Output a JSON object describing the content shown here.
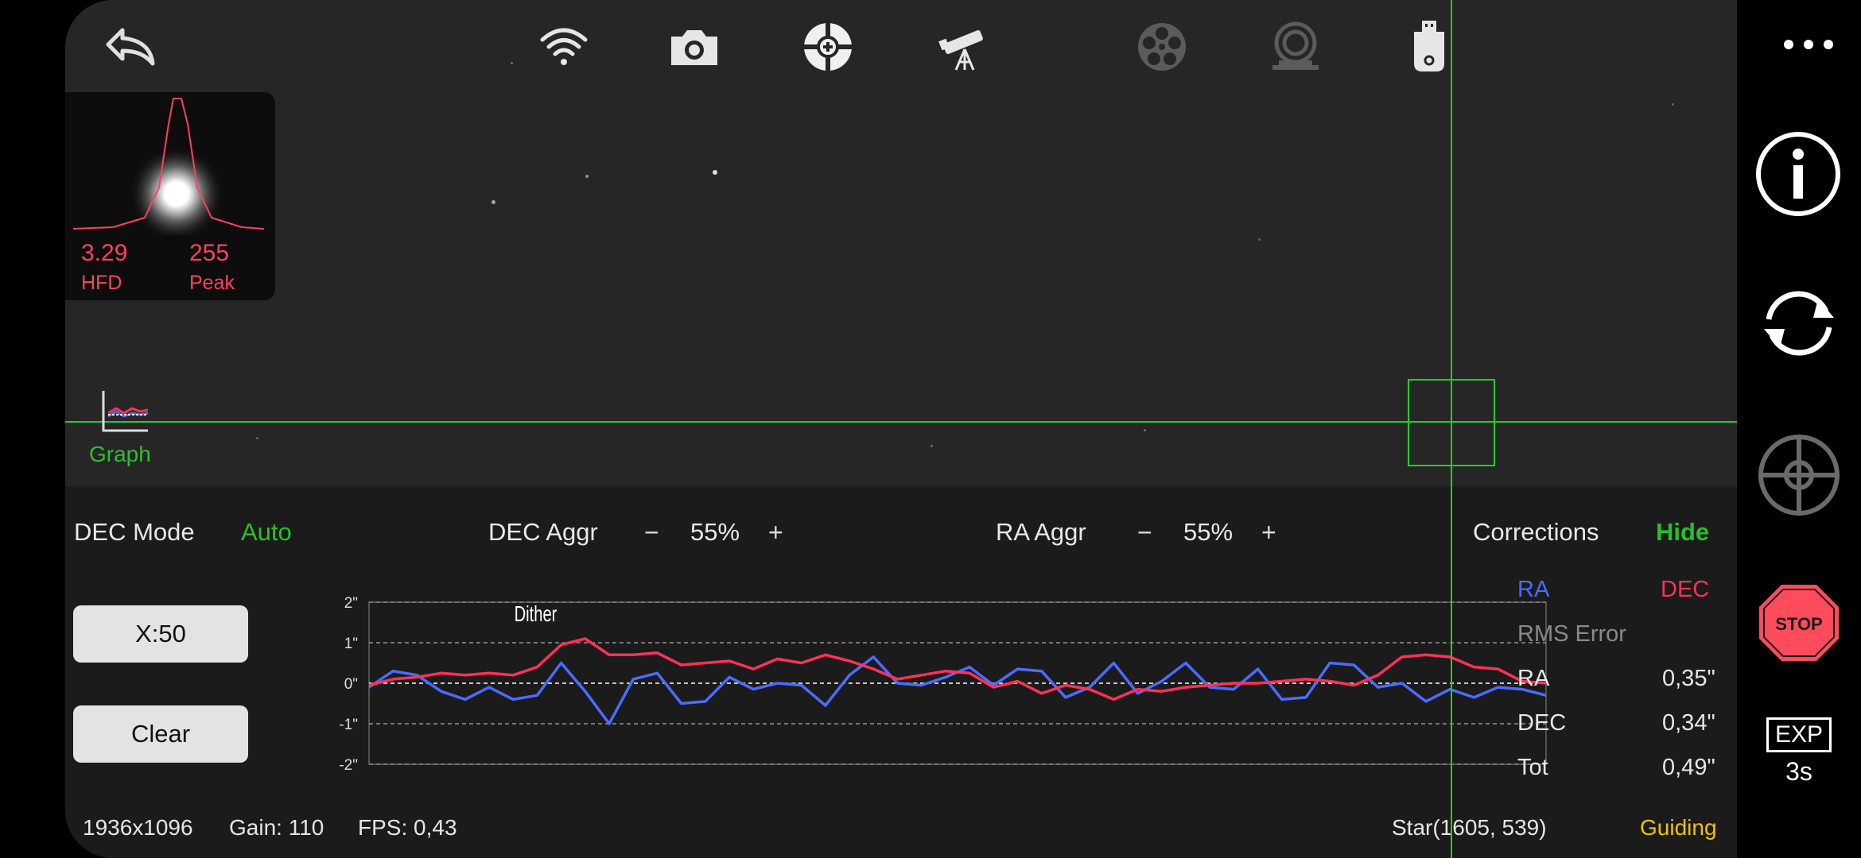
{
  "toolbar": {
    "icons": [
      "back-icon",
      "wifi-icon",
      "camera-icon",
      "guide-target-icon",
      "telescope-icon",
      "filter-wheel-icon",
      "focuser-icon",
      "usb-drive-icon"
    ]
  },
  "star_profile": {
    "hfd_value": "3.29",
    "hfd_label": "HFD",
    "peak_value": "255",
    "peak_label": "Peak"
  },
  "graph_toggle": {
    "label": "Graph"
  },
  "controls": {
    "dec_mode_label": "DEC Mode",
    "dec_mode_value": "Auto",
    "dec_aggr_label": "DEC Aggr",
    "dec_aggr_minus": "−",
    "dec_aggr_value": "55%",
    "dec_aggr_plus": "+",
    "ra_aggr_label": "RA Aggr",
    "ra_aggr_minus": "−",
    "ra_aggr_value": "55%",
    "ra_aggr_plus": "+",
    "corrections_label": "Corrections",
    "corrections_toggle": "Hide"
  },
  "buttons": {
    "x_scale": "X:50",
    "clear": "Clear"
  },
  "chart_data": {
    "type": "line",
    "yticks": [
      "2\"",
      "1\"",
      "0\"",
      "-1\"",
      "-2\""
    ],
    "ylim": [
      -2,
      2
    ],
    "annotation": "Dither",
    "grid": true,
    "series": [
      {
        "name": "RA",
        "color": "#4a6cff",
        "values": [
          -0.1,
          0.3,
          0.2,
          -0.2,
          -0.4,
          -0.1,
          -0.4,
          -0.3,
          0.5,
          -0.2,
          -1.0,
          0.1,
          0.25,
          -0.5,
          -0.45,
          0.15,
          -0.15,
          0.0,
          -0.05,
          -0.55,
          0.2,
          0.65,
          0.0,
          -0.05,
          0.15,
          0.4,
          -0.05,
          0.35,
          0.3,
          -0.35,
          -0.1,
          0.5,
          -0.25,
          0.05,
          0.5,
          -0.1,
          -0.15,
          0.35,
          -0.4,
          -0.35,
          0.5,
          0.45,
          -0.1,
          0.0,
          -0.45,
          -0.15,
          -0.35,
          -0.1,
          -0.15,
          -0.3
        ]
      },
      {
        "name": "DEC",
        "color": "#ff3158",
        "values": [
          -0.05,
          0.1,
          0.15,
          0.25,
          0.2,
          0.25,
          0.2,
          0.4,
          0.95,
          1.1,
          0.7,
          0.7,
          0.75,
          0.45,
          0.5,
          0.55,
          0.35,
          0.6,
          0.5,
          0.7,
          0.55,
          0.35,
          0.1,
          0.2,
          0.3,
          0.25,
          -0.1,
          0.05,
          -0.25,
          -0.05,
          -0.15,
          -0.4,
          -0.15,
          -0.2,
          -0.1,
          -0.05,
          0.0,
          0.0,
          0.05,
          0.1,
          0.05,
          -0.05,
          0.2,
          0.65,
          0.7,
          0.65,
          0.4,
          0.35,
          0.05,
          0.0
        ]
      }
    ]
  },
  "stats": {
    "ra_header": "RA",
    "dec_header": "DEC",
    "rms_label": "RMS Error",
    "ra_label": "RA",
    "ra_value": "0,35\"",
    "dec_label": "DEC",
    "dec_value": "0,34\"",
    "tot_label": "Tot",
    "tot_value": "0,49\""
  },
  "footer": {
    "resolution": "1936x1096",
    "gain": "Gain: 110",
    "fps": "FPS: 0,43",
    "star_pos": "Star(1605, 539)",
    "status": "Guiding"
  },
  "rail": {
    "stop_label": "STOP",
    "exp_label": "EXP",
    "exp_value": "3s"
  },
  "colors": {
    "green": "#1fd11f",
    "ra_blue": "#4a6cff",
    "dec_red": "#ff3158",
    "status_yellow": "#f2c200",
    "stop_red": "#ff4b5c"
  }
}
